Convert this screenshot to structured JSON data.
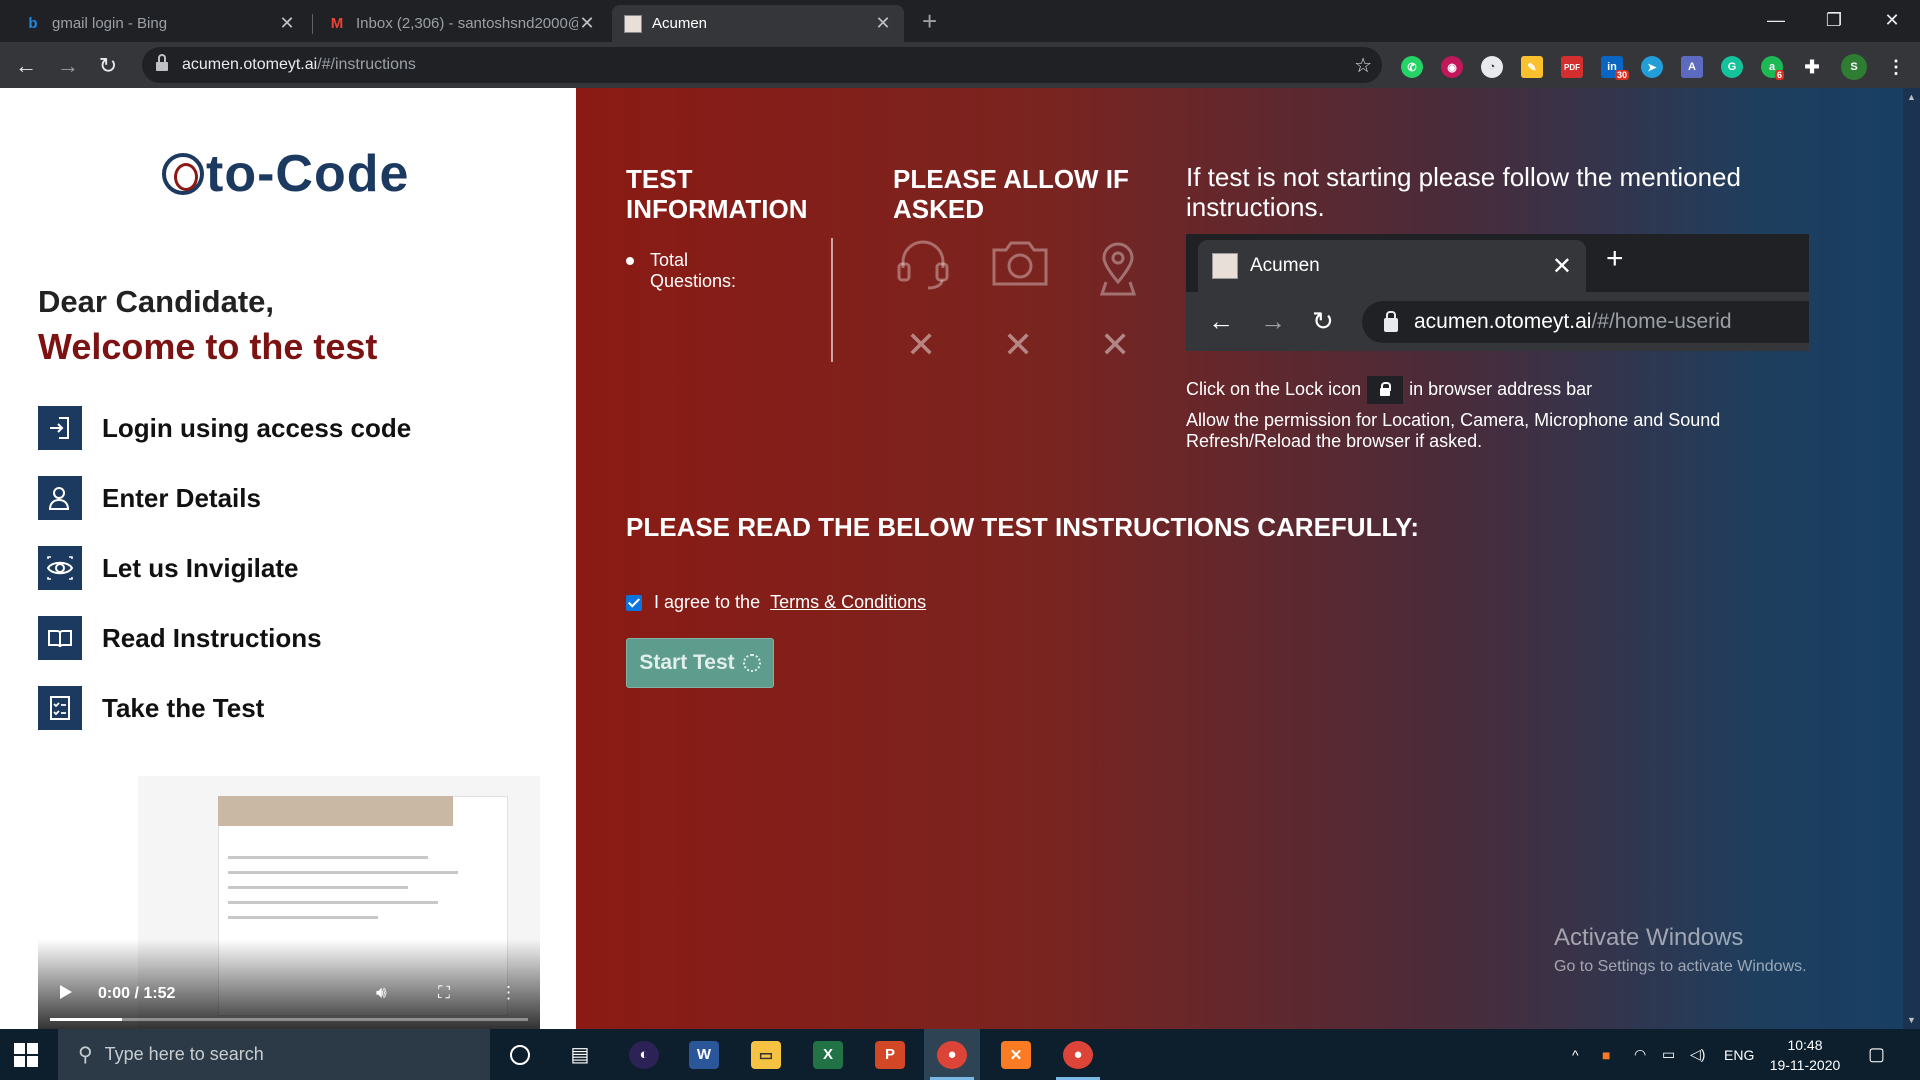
{
  "browser": {
    "tabs": [
      {
        "title": "gmail login - Bing",
        "close": "✕"
      },
      {
        "title": "Inbox (2,306) - santoshsnd2000@",
        "close": "✕"
      },
      {
        "title": "Acumen",
        "close": "✕"
      }
    ],
    "url_host": "acumen.otomeyt.ai",
    "url_path": "/#/instructions"
  },
  "left": {
    "logo_text": "to-Code",
    "greeting": "Dear Candidate,",
    "welcome": "Welcome to the test",
    "steps": [
      {
        "label": "Login using access code",
        "icon": "login-icon"
      },
      {
        "label": "Enter Details",
        "icon": "user-icon"
      },
      {
        "label": "Let us Invigilate",
        "icon": "eye-icon"
      },
      {
        "label": "Read Instructions",
        "icon": "book-icon"
      },
      {
        "label": "Take the Test",
        "icon": "checklist-icon"
      }
    ],
    "video": {
      "time": "0:00 / 1:52",
      "progress": 0.0
    }
  },
  "right": {
    "test_info_title": "TEST INFORMATION",
    "total_questions_label": "Total Questions:",
    "allow_title": "PLEASE ALLOW IF ASKED",
    "permissions": [
      "headset-icon",
      "camera-icon",
      "location-icon"
    ],
    "instructions_title": "If test is not starting please follow the mentioned instructions.",
    "mock_tab_title": "Acumen",
    "mock_url_host": "acumen.otomeyt.ai",
    "mock_url_path": "/#/home-userid",
    "lock_note_before": "Click on the Lock icon",
    "lock_note_after": "in browser address bar",
    "permission_note_1": "Allow the permission for Location, Camera, Microphone and Sound",
    "permission_note_2": "Refresh/Reload the browser if asked.",
    "read_title": "PLEASE READ THE BELOW TEST INSTRUCTIONS CAREFULLY:",
    "agree_text": "I agree to the",
    "terms_link": "Terms & Conditions",
    "agree_checked": true,
    "start_button": "Start Test"
  },
  "watermark": {
    "line1": "Activate Windows",
    "line2": "Go to Settings to activate Windows."
  },
  "taskbar": {
    "search_placeholder": "Type here to search",
    "lang": "ENG",
    "time": "10:48",
    "date": "19-11-2020"
  }
}
